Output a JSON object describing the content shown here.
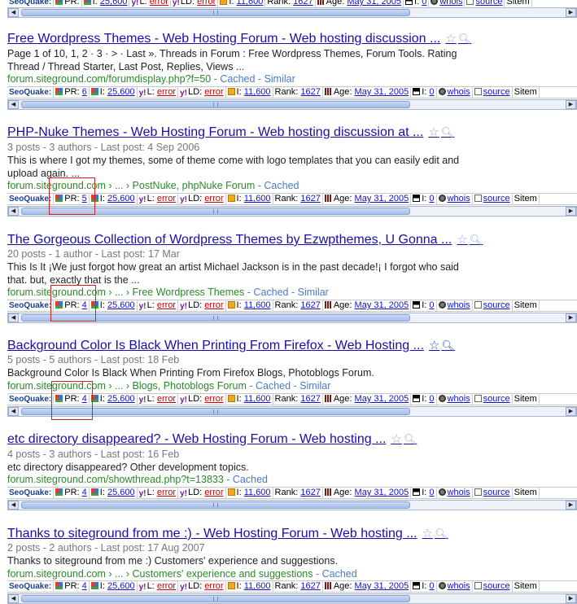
{
  "seoquake": {
    "label": "SeoQuake:",
    "pr_label": "PR:",
    "i_label": "I:",
    "l_label": "L:",
    "ld_label": "LD:",
    "rank_label": "Rank:",
    "age_label": "Age:",
    "whois": "whois",
    "source": "source",
    "sitemap": "Sitem",
    "error": "error"
  },
  "top_bar": {
    "pr": "",
    "i": "25,600",
    "ld_i": "11,600",
    "rank": "1627",
    "age": "May 31, 2005",
    "idx": "0"
  },
  "results": [
    {
      "title": "Free Wordpress Themes - Web Hosting Forum - Web hosting discussion ...",
      "snippet": "Page 1 of 10, 1, 2 · 3 · > · Last ». Threads in Forum : Free Wordpress Themes, Forum Tools. Rating Thread / Thread Starter, Last Post, Replies, Views ...",
      "url": "forum.siteground.com/forumdisplay.php?f=50",
      "links": " - Cached - Similar",
      "pr": "6",
      "i": "25,600",
      "ld_i": "11,600",
      "rank": "1627",
      "age": "May 31, 2005",
      "idx": "0"
    },
    {
      "title": "PHP-Nuke Themes - Web Hosting Forum - Web hosting discussion at ...",
      "meta": "3 posts - 3 authors - Last post: 4 Sep 2006",
      "snippet": "This is where I got my themes, some of theme come with logo templates that you can easily edit and upload again. ...",
      "url": "forum.siteground.com",
      "breadcrumb": " › ... › PostNuke, phpNuke Forum",
      "links": " - Cached",
      "pr": "5",
      "i": "25,600",
      "ld_i": "11,600",
      "rank": "1627",
      "age": "May 31, 2005",
      "idx": "0"
    },
    {
      "title": "The Gorgeous Collection of Wordpress Themes by Ezwpthemes, U Gonna ...",
      "meta": "20 posts - 1 author - Last post: 17 Mar",
      "snippet": "This Is It ¡We just forgot how great an artist Michael Jackson is in the past decade!¡ I forgot who said that. but, exactly that is the ...",
      "url": "forum.siteground.com",
      "breadcrumb": " › ... › Free Wordpress Themes",
      "links": " - Cached - Similar",
      "pr": "4",
      "i": "25,600",
      "ld_i": "11,600",
      "rank": "1627",
      "age": "May 31, 2005",
      "idx": "0"
    },
    {
      "title": "Background Color Is Black When Printing From Firefox - Web Hosting ...",
      "meta": "5 posts - 5 authors - Last post: 18 Feb",
      "snippet": "Background Color Is Black When Printing From Firefox Blogs, Photoblogs Forum.",
      "url": "forum.siteground.com",
      "breadcrumb": " › ... › Blogs, Photoblogs Forum",
      "links": " - Cached - Similar",
      "pr": "4",
      "i": "25,600",
      "ld_i": "11,600",
      "rank": "1627",
      "age": "May 31, 2005",
      "idx": "0"
    },
    {
      "title": "etc directory disappeared? - Web Hosting Forum - Web hosting ...",
      "meta": "4 posts - 3 authors - Last post: 16 Feb",
      "snippet": "etc directory disappeared? Other development topics.",
      "url": "forum.siteground.com/showthread.php?t=13833",
      "links": " - Cached",
      "pr": "4",
      "i": "25,600",
      "ld_i": "11,600",
      "rank": "1627",
      "age": "May 31, 2005",
      "idx": "0"
    },
    {
      "title": "Thanks to siteground from me :) - Web Hosting Forum - Web hosting ...",
      "meta": "2 posts - 2 authors - Last post: 17 Aug 2007",
      "snippet": "Thanks to siteground from me :) Customers' experience and suggestions.",
      "url": "forum.siteground.com",
      "breadcrumb": " › ... › Customers' experience and suggestions",
      "links": " - Cached",
      "pr": "4",
      "i": "25,600",
      "ld_i": "11,600",
      "rank": "1627",
      "age": "May 31, 2005",
      "idx": "0"
    }
  ]
}
